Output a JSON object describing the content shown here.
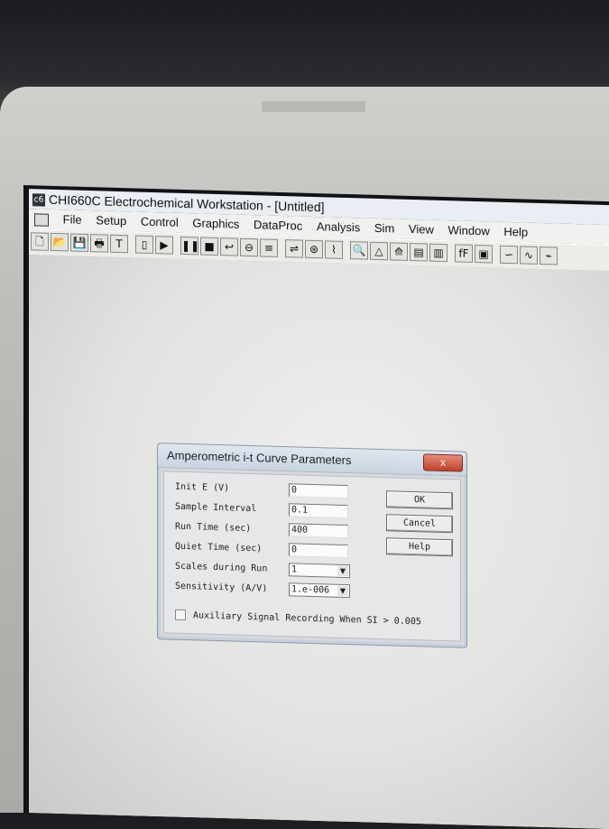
{
  "app": {
    "title": "CHI660C Electrochemical Workstation - [Untitled]",
    "icon_text": "c6"
  },
  "menubar": {
    "items": [
      "File",
      "Setup",
      "Control",
      "Graphics",
      "DataProc",
      "Analysis",
      "Sim",
      "View",
      "Window",
      "Help"
    ]
  },
  "toolbar": {
    "buttons": [
      {
        "name": "new-file-icon",
        "glyph": "🗋"
      },
      {
        "name": "open-folder-icon",
        "glyph": "📂"
      },
      {
        "name": "save-icon",
        "glyph": "💾"
      },
      {
        "name": "print-icon",
        "glyph": "🖶"
      },
      {
        "name": "technique-icon",
        "glyph": "T"
      },
      {
        "name": "parameters-icon",
        "glyph": "▯"
      },
      {
        "name": "run-icon",
        "glyph": "▶"
      },
      {
        "name": "pause-icon",
        "glyph": "❚❚"
      },
      {
        "name": "stop-icon",
        "glyph": "■"
      },
      {
        "name": "reverse-scan-icon",
        "glyph": "↩"
      },
      {
        "name": "ir-comp-icon",
        "glyph": "⊖"
      },
      {
        "name": "filter-icon",
        "glyph": "≡"
      },
      {
        "name": "cell-control-icon",
        "glyph": "⇌"
      },
      {
        "name": "step-function-icon",
        "glyph": "⊛"
      },
      {
        "name": "graphics-icon",
        "glyph": "⌇"
      },
      {
        "name": "zoom-icon",
        "glyph": "🔍"
      },
      {
        "name": "peak-icon",
        "glyph": "△"
      },
      {
        "name": "overlay-icon",
        "glyph": "⟰"
      },
      {
        "name": "mark-icon",
        "glyph": "▤"
      },
      {
        "name": "color-icon",
        "glyph": "▥"
      },
      {
        "name": "font-icon",
        "glyph": "fF"
      },
      {
        "name": "copy-icon",
        "glyph": "▣"
      },
      {
        "name": "smooth-icon",
        "glyph": "∽"
      },
      {
        "name": "derivative-icon",
        "glyph": "∿"
      },
      {
        "name": "integrate-icon",
        "glyph": "⌁"
      }
    ]
  },
  "dialog": {
    "title": "Amperometric i-t Curve Parameters",
    "close_label": "x",
    "fields": [
      {
        "label": "Init E (V)",
        "value": "0"
      },
      {
        "label": "Sample Interval",
        "value": "0.1"
      },
      {
        "label": "Run Time (sec)",
        "value": "400"
      },
      {
        "label": "Quiet Time (sec)",
        "value": "0"
      }
    ],
    "selects": [
      {
        "label": "Scales during Run",
        "value": "1"
      },
      {
        "label": "Sensitivity (A/V)",
        "value": "1.e-006"
      }
    ],
    "buttons": {
      "ok": "OK",
      "cancel": "Cancel",
      "help": "Help"
    },
    "checkbox": {
      "label": "Auxiliary Signal Recording When SI > 0.005",
      "checked": false
    }
  }
}
